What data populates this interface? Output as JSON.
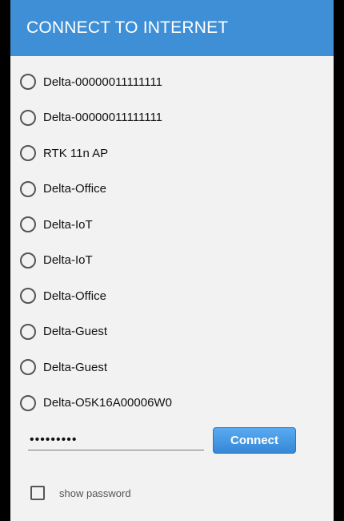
{
  "dialog": {
    "title": "CONNECT TO INTERNET"
  },
  "networks": [
    {
      "label": "Delta-00000011111111",
      "selected": false
    },
    {
      "label": "Delta-00000011111111",
      "selected": false
    },
    {
      "label": "RTK 11n AP",
      "selected": false
    },
    {
      "label": "Delta-Office",
      "selected": false
    },
    {
      "label": "Delta-IoT",
      "selected": false
    },
    {
      "label": "Delta-IoT",
      "selected": false
    },
    {
      "label": "Delta-Office",
      "selected": false
    },
    {
      "label": "Delta-Guest",
      "selected": false
    },
    {
      "label": "Delta-Guest",
      "selected": false
    },
    {
      "label": "Delta-O5K16A00006W0",
      "selected": false
    }
  ],
  "password": {
    "value": "•••••••••"
  },
  "connect_button": {
    "label": "Connect"
  },
  "show_password": {
    "label": "show password",
    "checked": false
  },
  "colors": {
    "header": "#3f8fd7",
    "button": "#3588d8"
  }
}
